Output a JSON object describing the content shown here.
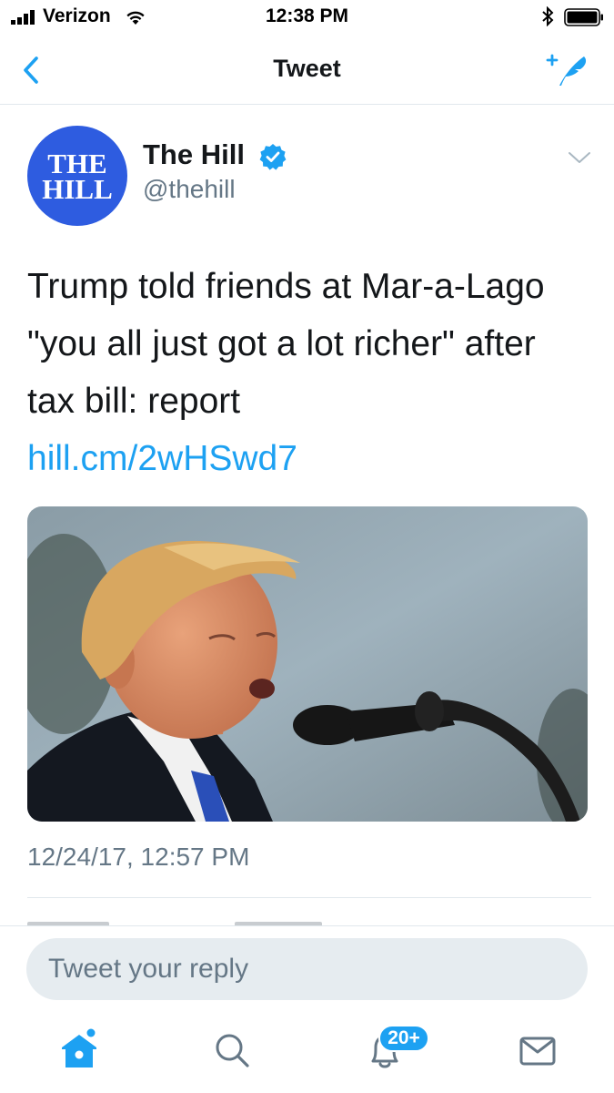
{
  "status_bar": {
    "carrier": "Verizon",
    "time": "12:38 PM",
    "icons": [
      "signal-icon",
      "wifi-icon",
      "bluetooth-icon",
      "battery-icon"
    ]
  },
  "nav": {
    "title": "Tweet",
    "back_icon": "chevron-left-icon",
    "compose_icon": "compose-tweet-icon"
  },
  "tweet": {
    "avatar_line1": "THE",
    "avatar_line2": "HILL",
    "author_name": "The Hill",
    "verified": true,
    "handle": "@thehill",
    "text": "Trump told friends at Mar-a-Lago \"you all just got a lot richer\" after tax bill: report",
    "link": "hill.cm/2wHSwd7",
    "timestamp": "12/24/17, 12:57 PM"
  },
  "reply": {
    "placeholder": "Tweet your reply"
  },
  "tab_bar": {
    "items": [
      {
        "name": "home",
        "icon": "home-icon",
        "active": true
      },
      {
        "name": "search",
        "icon": "search-icon",
        "active": false
      },
      {
        "name": "notifications",
        "icon": "bell-icon",
        "active": false
      },
      {
        "name": "messages",
        "icon": "envelope-icon",
        "active": false
      }
    ],
    "notifications_badge": "20+"
  },
  "colors": {
    "accent": "#1da1f2",
    "secondary_text": "#657786",
    "avatar_bg": "#2e5ce0",
    "divider": "#e1e8ed",
    "reply_bg": "#e6ecf0"
  }
}
